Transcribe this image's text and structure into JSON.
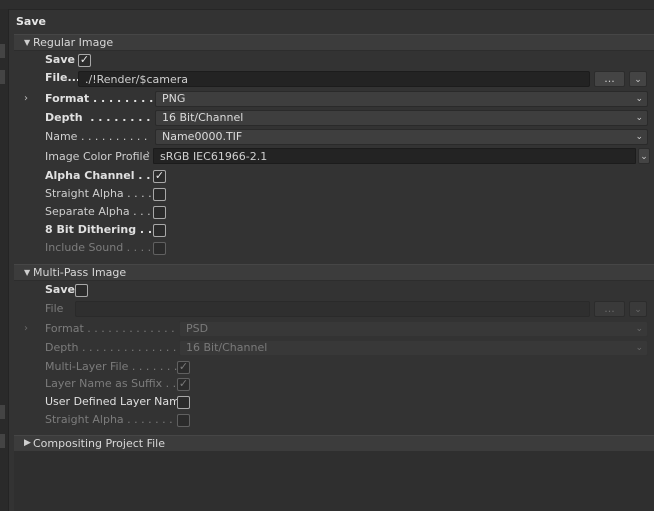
{
  "panel": {
    "title": "Save"
  },
  "regular": {
    "header": "Regular Image",
    "save_label": "Save",
    "save_checked": true,
    "file_label": "File...",
    "file_value": "./!Render/$camera",
    "browse_label": "...",
    "format_label": "Format . . . . . . . . .",
    "format_value": "PNG",
    "depth_label": "Depth  . . . . . . . . .",
    "depth_value": "16 Bit/Channel",
    "name_label": "Name . . . . . . . . . .",
    "name_value": "Name0000.TIF",
    "profile_label": "Image Color Profile",
    "profile_value": "sRGB IEC61966-2.1",
    "alpha_label": "Alpha Channel . . .",
    "alpha_checked": true,
    "straight_label": "Straight Alpha . . . .",
    "straight_checked": false,
    "separate_label": "Separate Alpha . . .",
    "separate_checked": false,
    "dither_label": "8 Bit Dithering . . .",
    "dither_checked": false,
    "sound_label": "Include Sound . . . .",
    "sound_checked": false
  },
  "multipass": {
    "header": "Multi-Pass Image",
    "save_label": "Save",
    "save_checked": false,
    "file_label": "File",
    "file_value": "",
    "browse_label": "...",
    "format_label": "Format . . . . . . . . . . . . .",
    "format_value": "PSD",
    "depth_label": "Depth . . . . . . . . . . . . . .",
    "depth_value": "16 Bit/Channel",
    "multilayer_label": "Multi-Layer File . . . . . . .",
    "multilayer_checked": true,
    "suffix_label": "Layer Name as Suffix . .",
    "suffix_checked": true,
    "userdef_label": "User Defined Layer Name",
    "userdef_checked": false,
    "straight_label": "Straight Alpha . . . . . . . .",
    "straight_checked": false
  },
  "compositing": {
    "header": "Compositing Project File"
  }
}
